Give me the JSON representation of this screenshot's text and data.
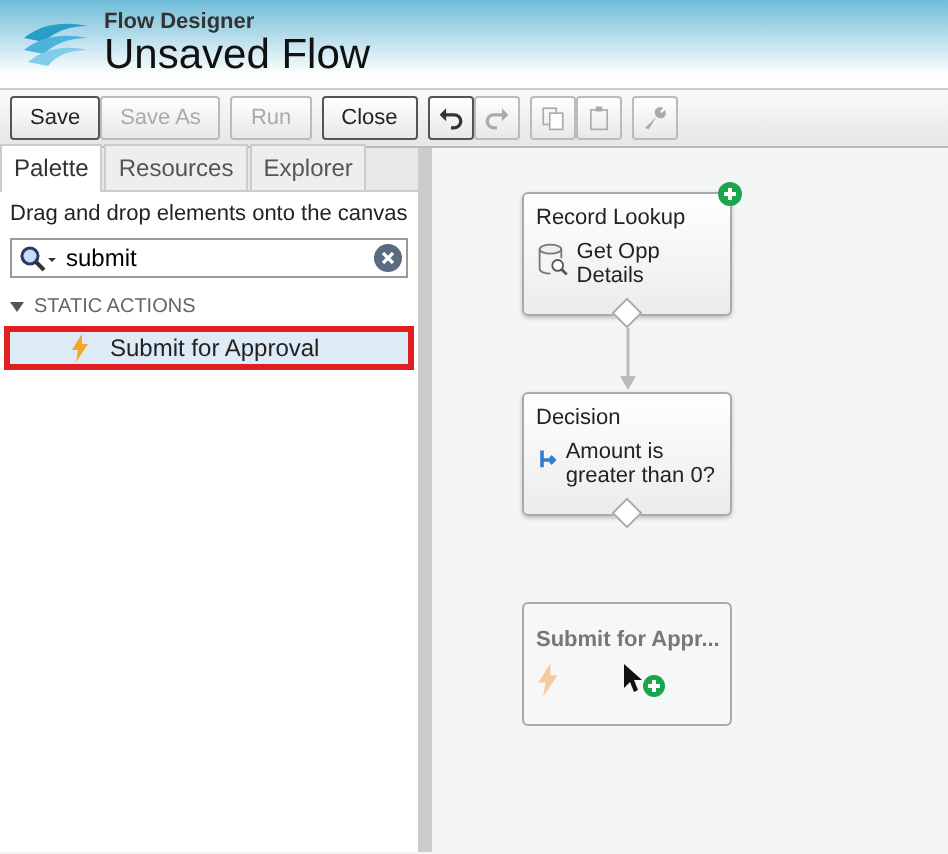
{
  "header": {
    "subtitle": "Flow Designer",
    "title": "Unsaved Flow"
  },
  "toolbar": [
    {
      "kind": "text",
      "label": "Save",
      "disabled": false
    },
    {
      "kind": "text",
      "label": "Save As",
      "disabled": true
    },
    {
      "kind": "text",
      "label": "Run",
      "disabled": true
    },
    {
      "kind": "text",
      "label": "Close",
      "disabled": false
    },
    {
      "kind": "undo",
      "disabled": false
    },
    {
      "kind": "redo",
      "disabled": true
    },
    {
      "kind": "copy",
      "disabled": true
    },
    {
      "kind": "paste",
      "disabled": true
    },
    {
      "kind": "wrench",
      "disabled": true
    }
  ],
  "tabs": [
    {
      "label": "Palette",
      "selected": true
    },
    {
      "label": "Resources",
      "selected": false
    },
    {
      "label": "Explorer",
      "selected": false
    }
  ],
  "palette": {
    "hint": "Drag and drop elements onto the canvas",
    "search": "submit",
    "sections": [
      {
        "label": "STATIC ACTIONS",
        "expanded": true,
        "items": [
          {
            "label": "Submit for Approval",
            "selected": true
          }
        ]
      }
    ]
  },
  "canvas": {
    "nodes": [
      {
        "kind": "lookup",
        "title": "Record Lookup",
        "label": "Get Opp Details",
        "start": true,
        "ghost": false
      },
      {
        "kind": "decision",
        "title": "Decision",
        "label": "Amount is greater than 0?",
        "start": false,
        "ghost": false
      },
      {
        "kind": "action",
        "title": "Submit for Appr...",
        "start": false,
        "ghost": true
      }
    ]
  }
}
